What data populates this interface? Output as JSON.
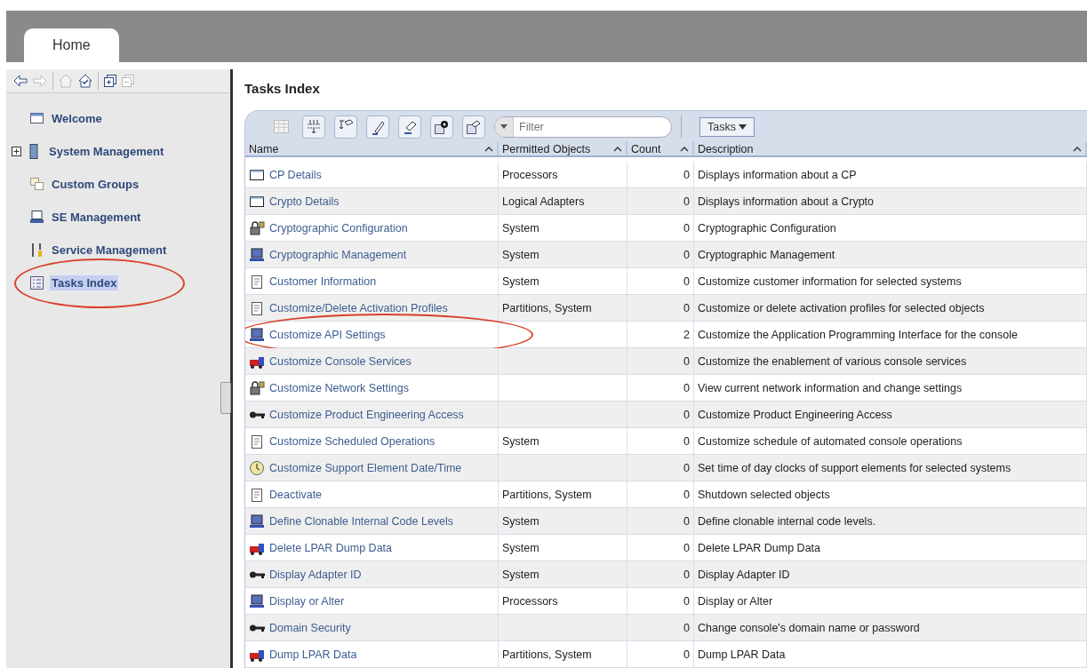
{
  "tabs": [
    {
      "label": "Home",
      "selected": true
    }
  ],
  "sidebar": {
    "items": [
      {
        "label": "Welcome",
        "kind": "leaf",
        "selected": false,
        "circled": false
      },
      {
        "label": "System Management",
        "kind": "group",
        "selected": false,
        "circled": false
      },
      {
        "label": "Custom Groups",
        "kind": "leaf",
        "selected": false,
        "circled": false
      },
      {
        "label": "SE Management",
        "kind": "leaf",
        "selected": false,
        "circled": false
      },
      {
        "label": "Service Management",
        "kind": "leaf",
        "selected": false,
        "circled": false
      },
      {
        "label": "Tasks Index",
        "kind": "leaf",
        "selected": true,
        "circled": true
      }
    ]
  },
  "content": {
    "title": "Tasks Index",
    "filter": {
      "placeholder": "Filter"
    },
    "tasks_button": "Tasks",
    "table": {
      "columns": [
        "Name",
        "Permitted Objects",
        "Count",
        "Description"
      ],
      "rows": [
        {
          "name": "CP Details",
          "objects": "Processors",
          "count": "0",
          "description": "Displays information about a CP",
          "circled": false
        },
        {
          "name": "Crypto Details",
          "objects": "Logical Adapters",
          "count": "0",
          "description": "Displays information about a Crypto",
          "circled": false
        },
        {
          "name": "Cryptographic Configuration",
          "objects": "System",
          "count": "0",
          "description": "Cryptographic Configuration",
          "circled": false
        },
        {
          "name": "Cryptographic Management",
          "objects": "System",
          "count": "0",
          "description": "Cryptographic Management",
          "circled": false
        },
        {
          "name": "Customer Information",
          "objects": "System",
          "count": "0",
          "description": "Customize customer information for selected systems",
          "circled": false
        },
        {
          "name": "Customize/Delete Activation Profiles",
          "objects": "Partitions, System",
          "count": "0",
          "description": "Customize or delete activation profiles for selected objects",
          "circled": false
        },
        {
          "name": "Customize API Settings",
          "count": "2",
          "description": "Customize the Application Programming Interface for the console",
          "circled": true
        },
        {
          "name": "Customize Console Services",
          "count": "0",
          "description": "Customize the enablement of various console services",
          "circled": false
        },
        {
          "name": "Customize Network Settings",
          "count": "0",
          "description": "View current network information and change settings",
          "circled": false
        },
        {
          "name": "Customize Product Engineering Access",
          "count": "0",
          "description": "Customize Product Engineering Access",
          "circled": false
        },
        {
          "name": "Customize Scheduled Operations",
          "objects": "System",
          "count": "0",
          "description": "Customize schedule of automated console operations",
          "circled": false
        },
        {
          "name": "Customize Support Element Date/Time",
          "count": "0",
          "description": "Set time of day clocks of support elements for selected systems",
          "circled": false
        },
        {
          "name": "Deactivate",
          "objects": "Partitions, System",
          "count": "0",
          "description": "Shutdown selected objects",
          "circled": false
        },
        {
          "name": "Define Clonable Internal Code Levels",
          "objects": "System",
          "count": "0",
          "description": "Define clonable internal code levels.",
          "circled": false
        },
        {
          "name": "Delete LPAR Dump Data",
          "objects": "System",
          "count": "0",
          "description": "Delete LPAR Dump Data",
          "circled": false
        },
        {
          "name": "Display Adapter ID",
          "objects": "System",
          "count": "0",
          "description": "Display Adapter ID",
          "circled": false
        },
        {
          "name": "Display or Alter",
          "objects": "Processors",
          "count": "0",
          "description": "Display or Alter",
          "circled": false
        },
        {
          "name": "Domain Security",
          "count": "0",
          "description": "Change console's domain name or password",
          "circled": false
        },
        {
          "name": "Dump LPAR Data",
          "objects": "Partitions, System",
          "count": "0",
          "description": "Dump LPAR Data",
          "circled": false
        }
      ]
    }
  }
}
